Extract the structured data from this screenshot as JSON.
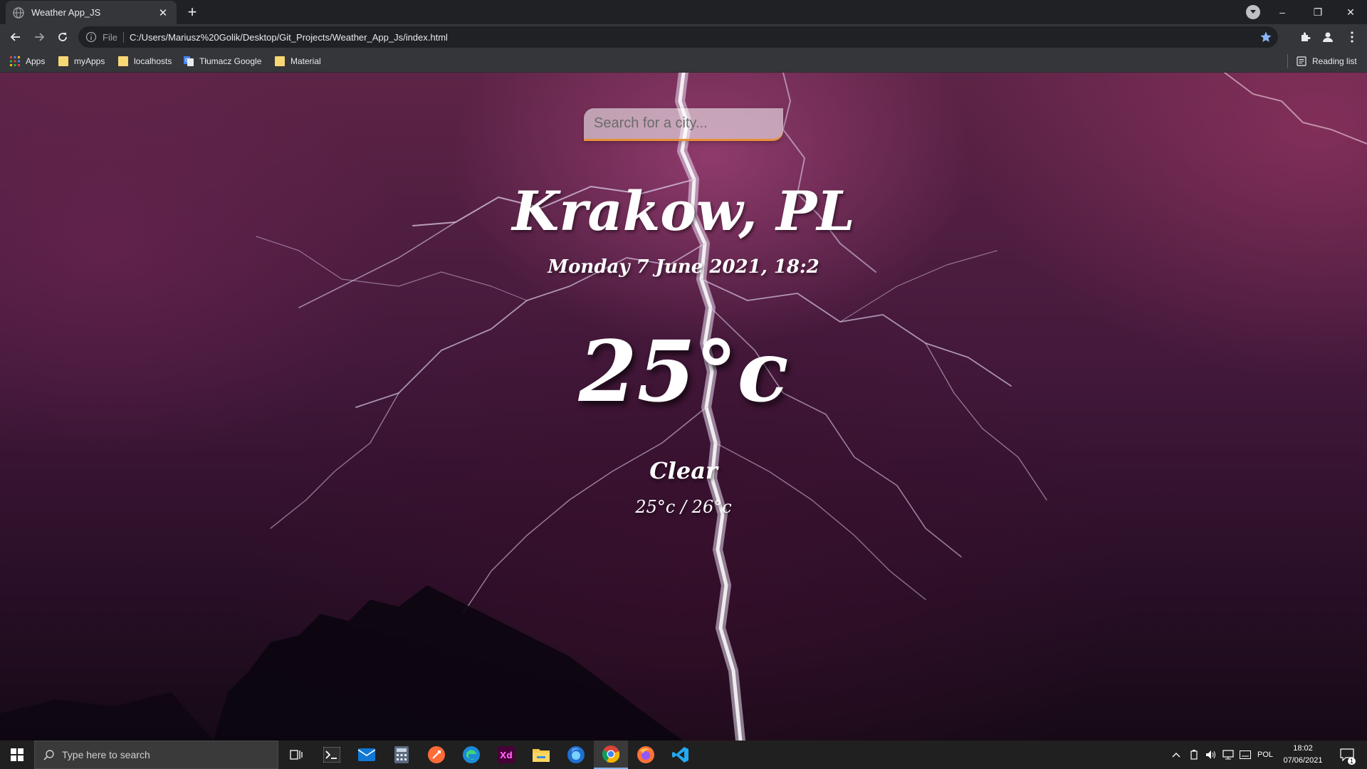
{
  "browser": {
    "tab_title": "Weather App_JS",
    "tab_close": "✕",
    "new_tab": "+",
    "scheme": "File",
    "url": "C:/Users/Mariusz%20Golik/Desktop/Git_Projects/Weather_App_Js/index.html",
    "window_controls": {
      "minimize": "–",
      "restore": "❐",
      "close": "✕"
    }
  },
  "bookmarks": [
    {
      "label": "Apps",
      "icon": "apps-grid-icon"
    },
    {
      "label": "myApps",
      "icon": "folder-icon"
    },
    {
      "label": "localhosts",
      "icon": "folder-icon"
    },
    {
      "label": "Tłumacz Google",
      "icon": "google-translate-icon"
    },
    {
      "label": "Material",
      "icon": "folder-icon"
    }
  ],
  "reading_list": "Reading list",
  "weather": {
    "search_placeholder": "Search for a city...",
    "city": "Krakow, PL",
    "date": "Monday 7 June 2021, 18:2",
    "temp": "25°c",
    "condition": "Clear",
    "hilo": "25°c / 26°c"
  },
  "taskbar": {
    "search_placeholder": "Type here to search",
    "language": "POL",
    "time": "18:02",
    "date": "07/06/2021",
    "notification_count": "1"
  },
  "colors": {
    "search_underline": "#e8913a",
    "chrome_dark": "#202124",
    "chrome_toolbar": "#35363a",
    "taskbar": "#202020"
  }
}
